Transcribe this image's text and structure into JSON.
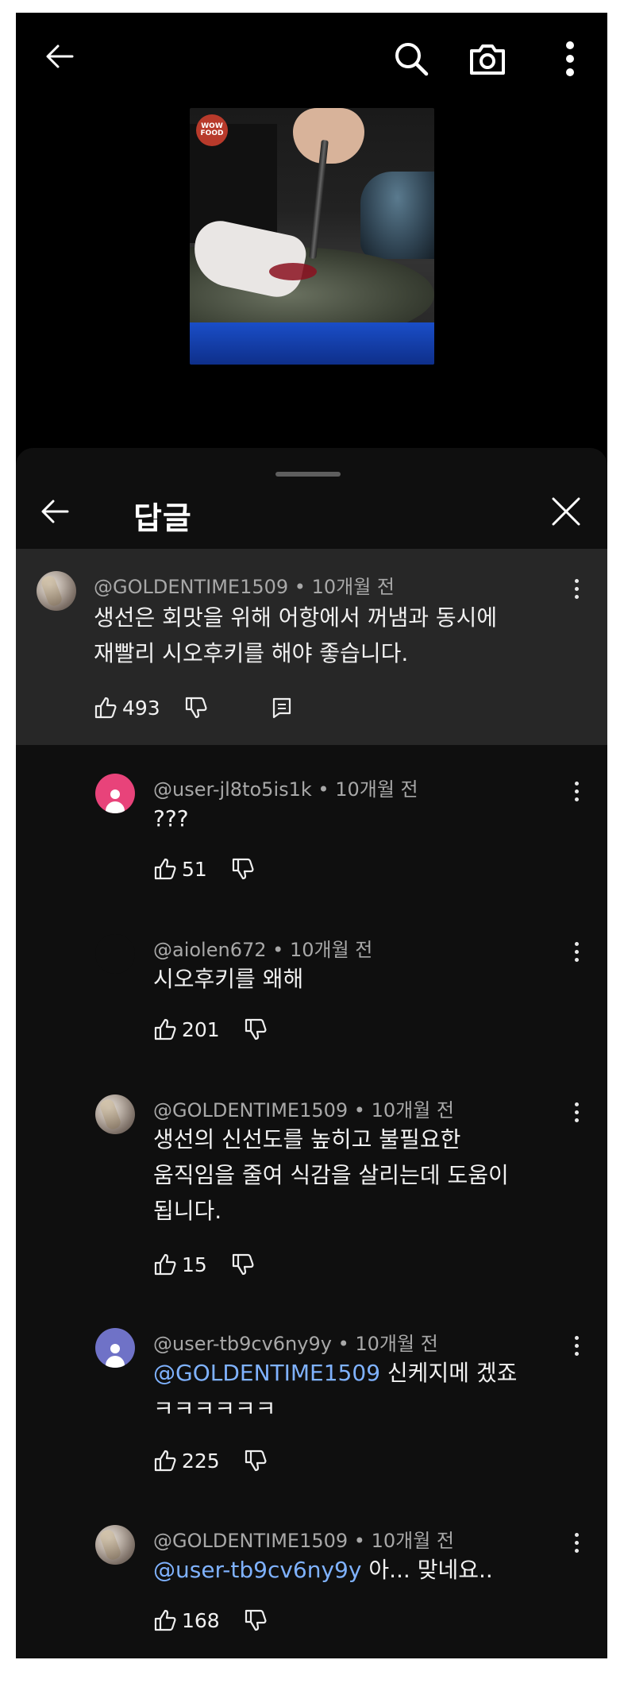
{
  "sheet": {
    "title": "답글"
  },
  "video": {
    "logo_text": "WOW FOOD"
  },
  "parent_comment": {
    "author": "@GOLDENTIME1509",
    "time": "10개월 전",
    "lines": [
      "생선은 회맛을 위해 어항에서 꺼냄과 동시에",
      "재빨리 시오후키를 해야 좋습니다."
    ],
    "likes": "493"
  },
  "replies": [
    {
      "author": "@user-jl8to5is1k",
      "time": "10개월 전",
      "lines": [
        "???"
      ],
      "likes": "51"
    },
    {
      "author": "@aiolen672",
      "time": "10개월 전",
      "lines": [
        "시오후키를 왜해"
      ],
      "likes": "201"
    },
    {
      "author": "@GOLDENTIME1509",
      "time": "10개월 전",
      "lines": [
        "생선의 신선도를 높히고 불필요한",
        "움직임을 줄여 식감을 살리는데 도움이",
        "됩니다."
      ],
      "likes": "15"
    },
    {
      "author": "@user-tb9cv6ny9y",
      "time": "10개월 전",
      "mention": "@GOLDENTIME1509",
      "text_after_mention": "신케지메 겠죠",
      "lines": [
        "ㅋㅋㅋㅋㅋㅋ"
      ],
      "likes": "225"
    },
    {
      "author": "@GOLDENTIME1509",
      "time": "10개월 전",
      "mention": "@user-tb9cv6ny9y",
      "text_after_mention": "아... 맞네요..",
      "likes": "168"
    }
  ],
  "separator": "•",
  "icons": {
    "back": "arrow-left-icon",
    "search": "search-icon",
    "camera": "camera-icon",
    "more": "more-vert-icon",
    "close": "close-icon",
    "like": "thumb-up-icon",
    "dislike": "thumb-down-icon",
    "reply": "comment-icon"
  },
  "colors": {
    "background": "#000000",
    "sheet": "#0f0f0f",
    "highlight": "#272727",
    "mention": "#7fb2ff",
    "meta_text": "#a8a8a8"
  }
}
